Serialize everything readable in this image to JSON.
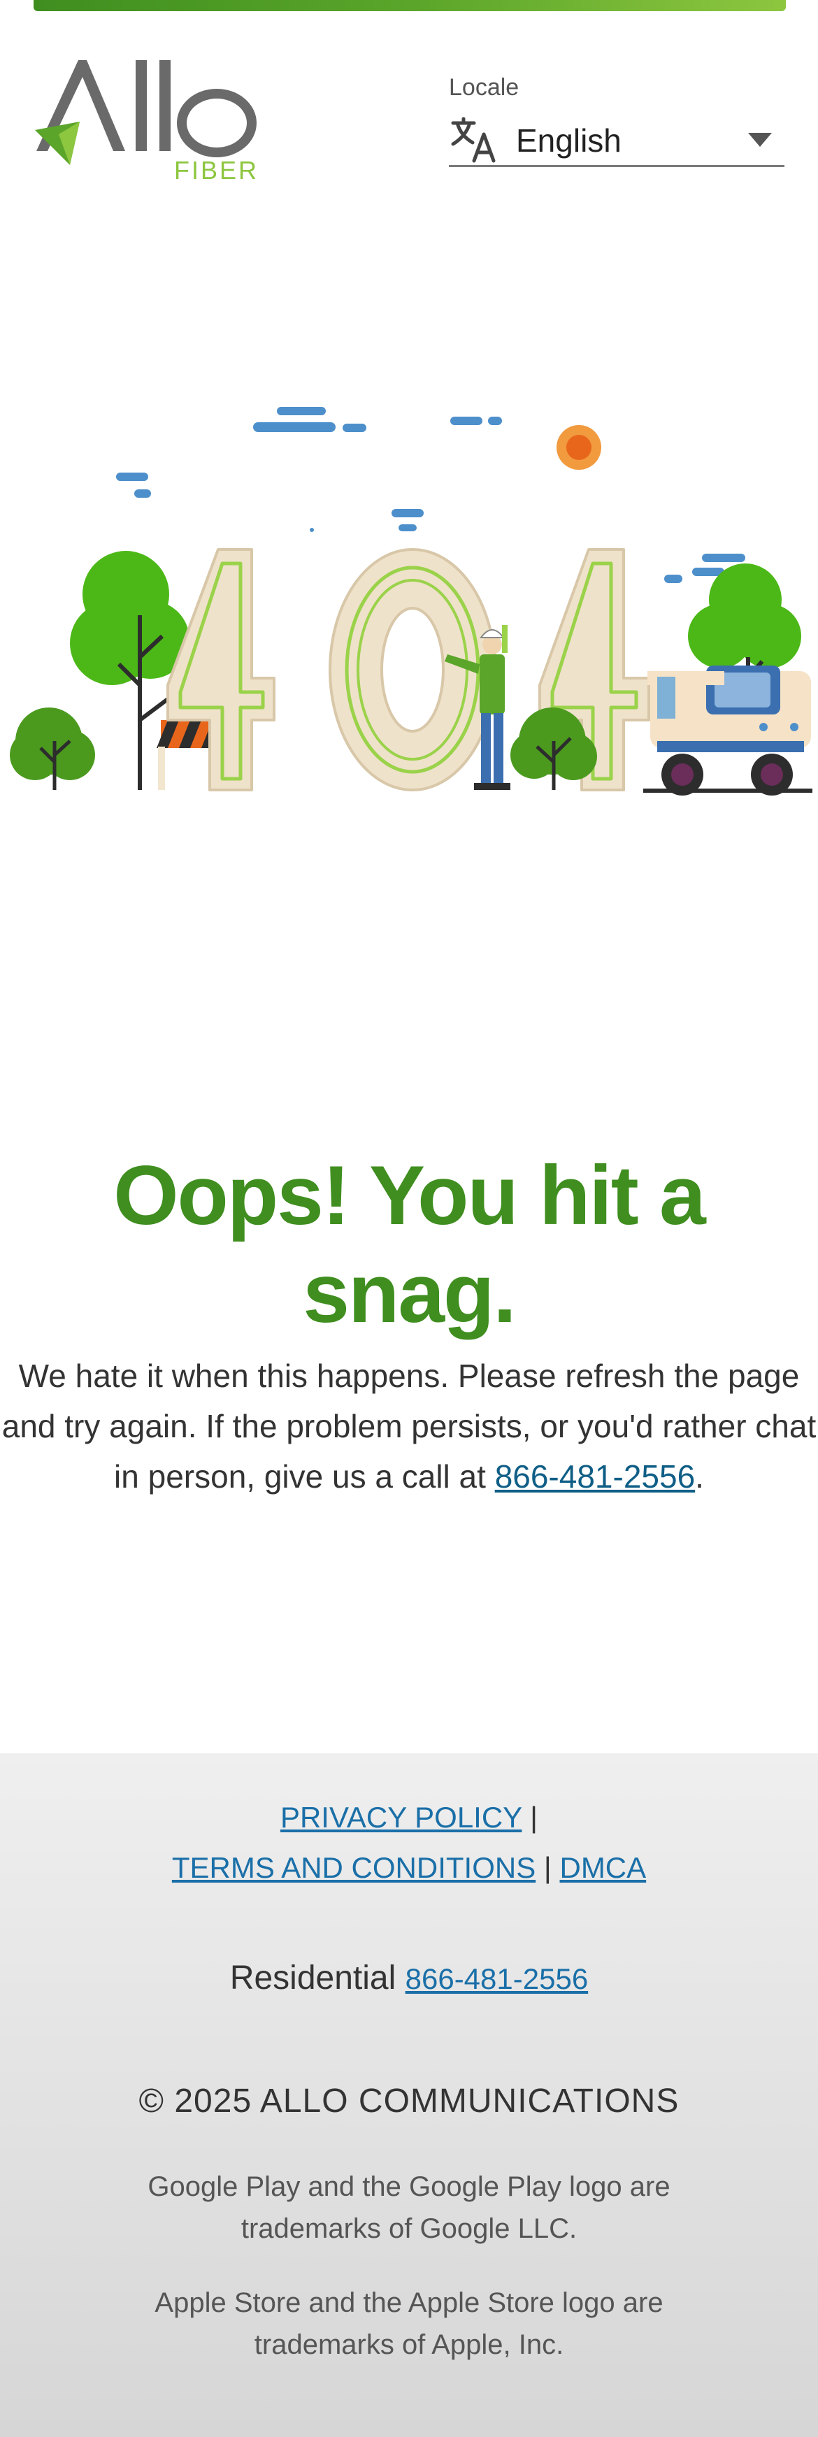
{
  "header": {
    "logo_text": "Allo",
    "logo_sub": "FIBER",
    "locale_label": "Locale",
    "locale_value": "English"
  },
  "illustration": {
    "text": "404"
  },
  "main": {
    "headline": "Oops! You hit a snag.",
    "message_text": "We hate it when this happens. Please refresh the page and try again. If the problem persists, or you'd rather chat in person, give us a call at ",
    "phone": "866-481-2556",
    "message_end": "."
  },
  "footer": {
    "privacy_label": "PRIVACY POLICY",
    "terms_label": "TERMS AND CONDITIONS",
    "dmca_label": "DMCA",
    "separator": "|",
    "residential_label": "Residential",
    "residential_phone": "866-481-2556",
    "copyright": "© 2025 ALLO COMMUNICATIONS",
    "google_trademark": "Google Play and the Google Play logo are trademarks of Google LLC.",
    "apple_trademark": "Apple Store and the Apple Store logo are trademarks of Apple, Inc."
  },
  "colors": {
    "brand_green": "#3f8e1f",
    "light_green": "#8dc63f",
    "link_blue": "#1a6fa8",
    "logo_gray": "#666666"
  },
  "icons": [
    "allo-logo",
    "translate-icon",
    "chevron-down-icon",
    "404-illustration"
  ]
}
